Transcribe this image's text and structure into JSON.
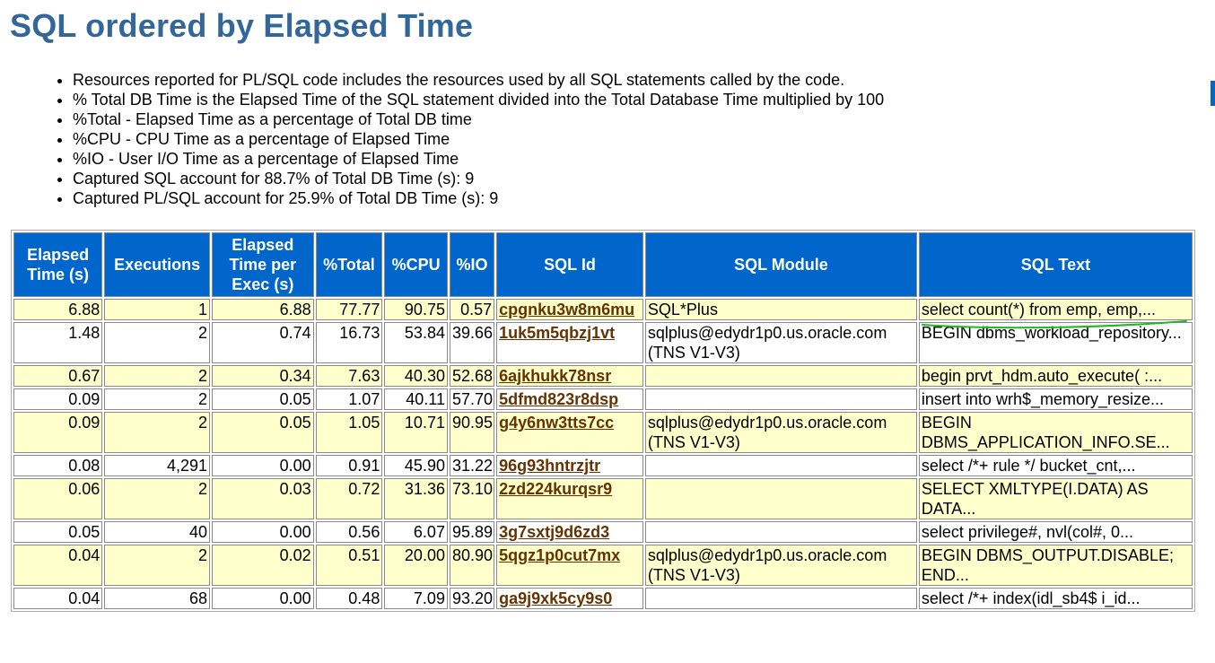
{
  "page": {
    "title": "SQL ordered by Elapsed Time",
    "notes": [
      "Resources reported for PL/SQL code includes the resources used by all SQL statements called by the code.",
      "% Total DB Time is the Elapsed Time of the SQL statement divided into the Total Database Time multiplied by 100",
      "%Total - Elapsed Time as a percentage of Total DB time",
      "%CPU - CPU Time as a percentage of Elapsed Time",
      "%IO - User I/O Time as a percentage of Elapsed Time",
      "Captured SQL account for 88.7% of Total DB Time (s): 9",
      "Captured PL/SQL account for 25.9% of Total DB Time (s): 9"
    ]
  },
  "table": {
    "headers": [
      "Elapsed Time (s)",
      "Executions",
      "Elapsed Time per Exec (s)",
      "%Total",
      "%CPU",
      "%IO",
      "SQL Id",
      "SQL Module",
      "SQL Text"
    ],
    "rows": [
      {
        "elapsed": "6.88",
        "executions": "1",
        "per_exec": "6.88",
        "total": "77.77",
        "cpu": "90.75",
        "io": "0.57",
        "sql_id": "cpgnku3w8m6mu",
        "module": "SQL*Plus",
        "text": "select count(*) from emp, emp,..."
      },
      {
        "elapsed": "1.48",
        "executions": "2",
        "per_exec": "0.74",
        "total": "16.73",
        "cpu": "53.84",
        "io": "39.66",
        "sql_id": "1uk5m5qbzj1vt",
        "module": "sqlplus@edydr1p0.us.oracle.com (TNS V1-V3)",
        "text": "BEGIN dbms_workload_repository..."
      },
      {
        "elapsed": "0.67",
        "executions": "2",
        "per_exec": "0.34",
        "total": "7.63",
        "cpu": "40.30",
        "io": "52.68",
        "sql_id": "6ajkhukk78nsr",
        "module": "",
        "text": "begin prvt_hdm.auto_execute( :..."
      },
      {
        "elapsed": "0.09",
        "executions": "2",
        "per_exec": "0.05",
        "total": "1.07",
        "cpu": "40.11",
        "io": "57.70",
        "sql_id": "5dfmd823r8dsp",
        "module": "",
        "text": "insert into wrh$_memory_resize..."
      },
      {
        "elapsed": "0.09",
        "executions": "2",
        "per_exec": "0.05",
        "total": "1.05",
        "cpu": "10.71",
        "io": "90.95",
        "sql_id": "g4y6nw3tts7cc",
        "module": "sqlplus@edydr1p0.us.oracle.com (TNS V1-V3)",
        "text": "BEGIN DBMS_APPLICATION_INFO.SE..."
      },
      {
        "elapsed": "0.08",
        "executions": "4,291",
        "per_exec": "0.00",
        "total": "0.91",
        "cpu": "45.90",
        "io": "31.22",
        "sql_id": "96g93hntrzjtr",
        "module": "",
        "text": "select /*+ rule */ bucket_cnt,..."
      },
      {
        "elapsed": "0.06",
        "executions": "2",
        "per_exec": "0.03",
        "total": "0.72",
        "cpu": "31.36",
        "io": "73.10",
        "sql_id": "2zd224kurqsr9",
        "module": "",
        "text": "SELECT XMLTYPE(I.DATA) AS DATA..."
      },
      {
        "elapsed": "0.05",
        "executions": "40",
        "per_exec": "0.00",
        "total": "0.56",
        "cpu": "6.07",
        "io": "95.89",
        "sql_id": "3g7sxtj9d6zd3",
        "module": "",
        "text": "select privilege#, nvl(col#, 0..."
      },
      {
        "elapsed": "0.04",
        "executions": "2",
        "per_exec": "0.02",
        "total": "0.51",
        "cpu": "20.00",
        "io": "80.90",
        "sql_id": "5qgz1p0cut7mx",
        "module": "sqlplus@edydr1p0.us.oracle.com (TNS V1-V3)",
        "text": "BEGIN DBMS_OUTPUT.DISABLE; END..."
      },
      {
        "elapsed": "0.04",
        "executions": "68",
        "per_exec": "0.00",
        "total": "0.48",
        "cpu": "7.09",
        "io": "93.20",
        "sql_id": "ga9j9xk5cy9s0",
        "module": "",
        "text": "select /*+ index(idl_sb4$ i_id..."
      }
    ]
  },
  "colors": {
    "title": "#336699",
    "header_bg": "#0066cc",
    "odd_row_bg": "#ffffcc",
    "link": "#663300",
    "annotation": "#22b822"
  }
}
